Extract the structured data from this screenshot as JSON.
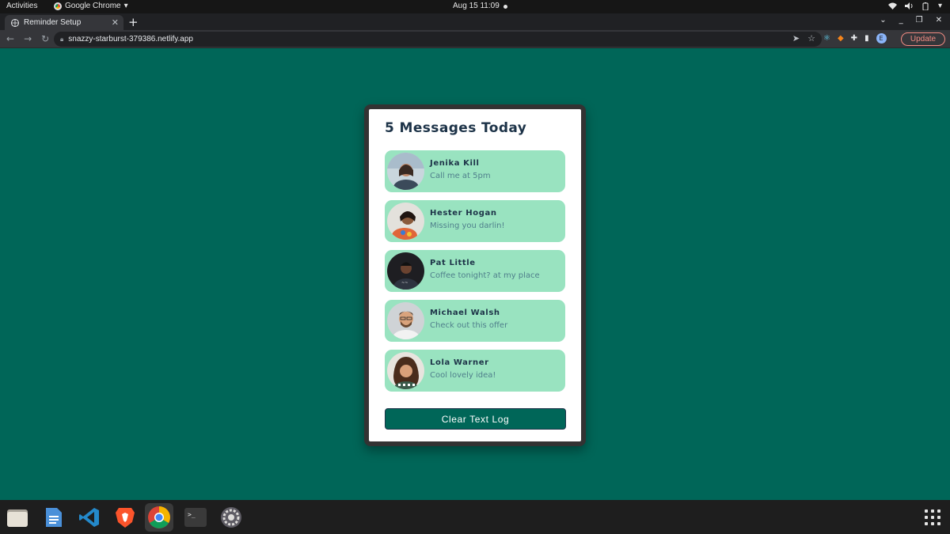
{
  "system": {
    "activities": "Activities",
    "app_name": "Google Chrome",
    "clock": "Aug 15  11:09"
  },
  "browser": {
    "tab_title": "Reminder Setup",
    "url": "snazzy-starburst-379386.netlify.app",
    "profile_initial": "E",
    "update_label": "Update"
  },
  "card": {
    "title": "5 Messages Today",
    "messages": [
      {
        "name": "Jenika Kill",
        "text": "Call me at 5pm"
      },
      {
        "name": "Hester Hogan",
        "text": "Missing you darlin!"
      },
      {
        "name": "Pat Little",
        "text": "Coffee tonight? at my place"
      },
      {
        "name": "Michael Walsh",
        "text": "Check out this offer"
      },
      {
        "name": "Lola Warner",
        "text": "Cool lovely idea!"
      }
    ],
    "clear_label": "Clear Text Log"
  },
  "colors": {
    "page_bg": "#006658",
    "card_bg": "#ffffff",
    "message_bg": "#99e3c0",
    "title_color": "#1d3348",
    "message_text": "#4f7f8b",
    "button_bg": "#006658"
  },
  "dock": {
    "items": [
      "files-icon",
      "text-editor-icon",
      "vscode-icon",
      "brave-icon",
      "chrome-icon",
      "terminal-icon",
      "settings-icon"
    ]
  }
}
